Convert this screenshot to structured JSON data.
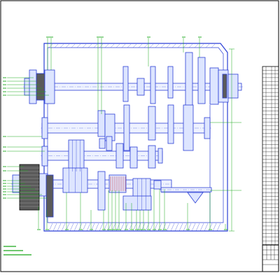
{
  "colors": {
    "outline": "#2b3fd6",
    "part_fill": "#dde5ff",
    "shaft_fill": "#eef2ff",
    "leader": "#1aa81a",
    "frame": "#000000",
    "dark_part": "#5a5a5a",
    "table_line": "#000000"
  }
}
